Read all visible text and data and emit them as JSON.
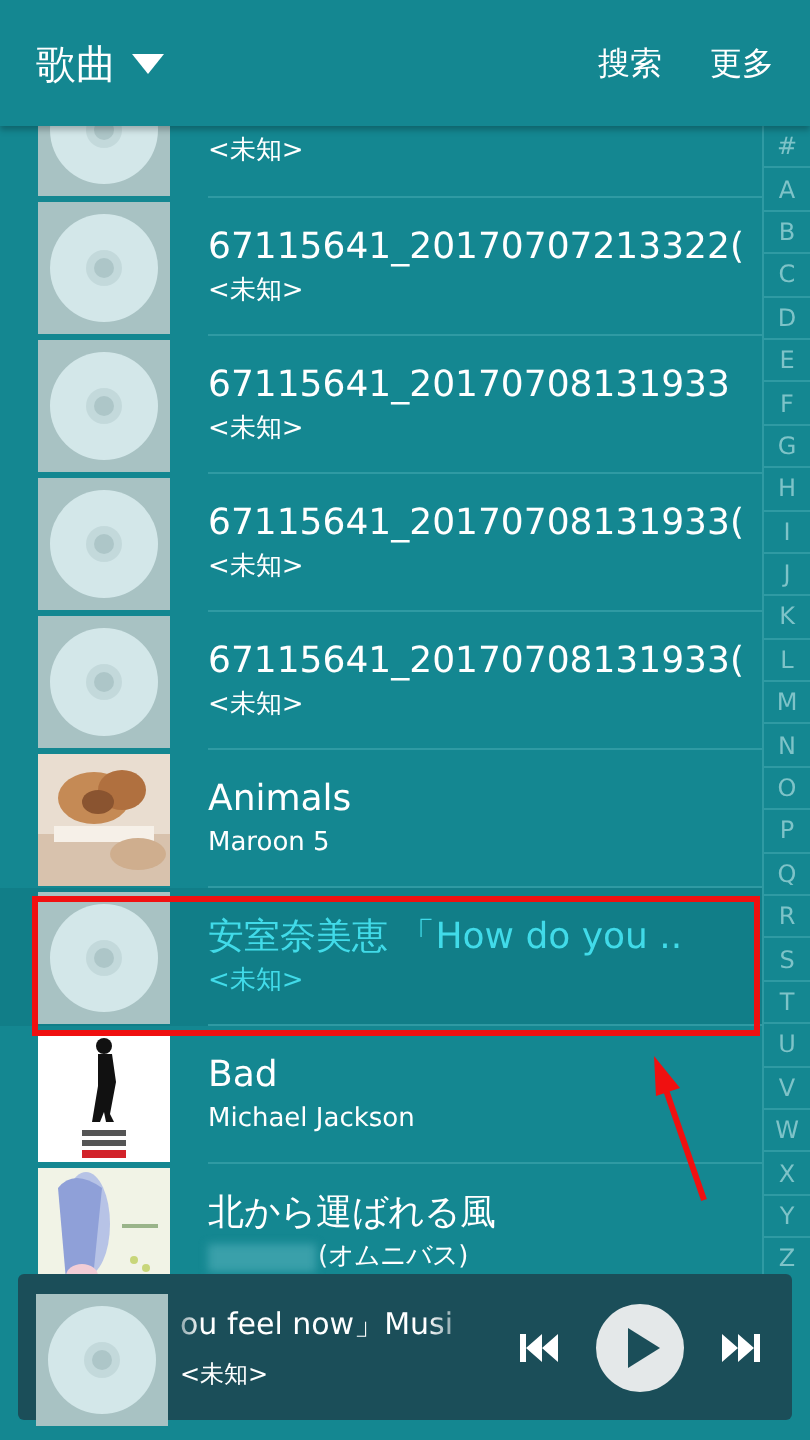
{
  "header": {
    "title": "歌曲",
    "actions": [
      "搜索",
      "更多"
    ]
  },
  "songs": [
    {
      "kind": "disc",
      "subtitle": "<未知>",
      "selected": false
    },
    {
      "kind": "disc",
      "title": "67115641_20170707213322(",
      "subtitle": "<未知>",
      "selected": false
    },
    {
      "kind": "disc",
      "title": "67115641_20170708131933",
      "subtitle": "<未知>",
      "selected": false
    },
    {
      "kind": "disc",
      "title": "67115641_20170708131933(",
      "subtitle": "<未知>",
      "selected": false
    },
    {
      "kind": "disc",
      "title": "67115641_20170708131933(",
      "subtitle": "<未知>",
      "selected": false
    },
    {
      "kind": "picture",
      "title": "Animals",
      "subtitle": "Maroon 5",
      "selected": false
    },
    {
      "kind": "disc",
      "title": "安室奈美恵 「How do you ..",
      "subtitle": "<未知>",
      "selected": true
    },
    {
      "kind": "picture",
      "title": "Bad",
      "subtitle": "Michael Jackson",
      "selected": false
    },
    {
      "kind": "picture",
      "title": "北から運ばれる風",
      "subtitle": "(オムニバス)",
      "redacted": true,
      "selected": false
    }
  ],
  "index": [
    "#",
    "A",
    "B",
    "C",
    "D",
    "E",
    "F",
    "G",
    "H",
    "I",
    "J",
    "K",
    "L",
    "M",
    "N",
    "O",
    "P",
    "Q",
    "R",
    "S",
    "T",
    "U",
    "V",
    "W",
    "X",
    "Y",
    "Z"
  ],
  "player": {
    "title": "ou feel now」Musi",
    "subtitle": "<未知>",
    "playing": false
  }
}
